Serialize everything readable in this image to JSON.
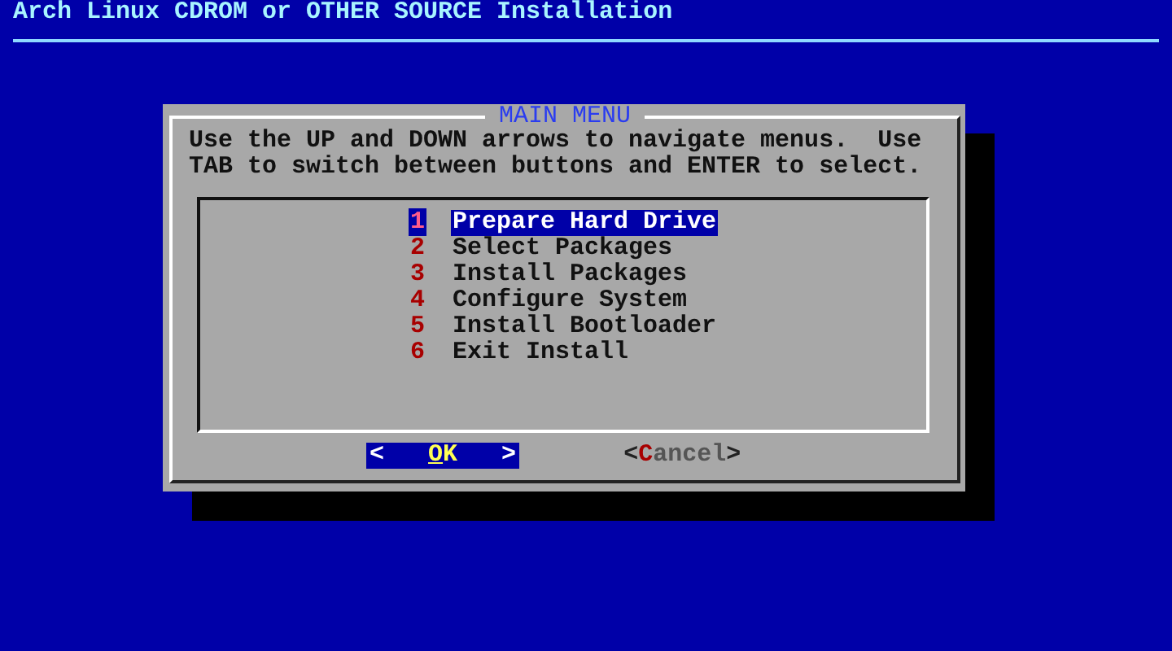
{
  "screen": {
    "title": "Arch Linux CDROM or OTHER SOURCE Installation"
  },
  "dialog": {
    "title": "MAIN MENU",
    "instructions": "Use the UP and DOWN arrows to navigate menus.  Use TAB to switch between buttons and ENTER to select.",
    "menu": [
      {
        "number": "1",
        "label": "Prepare Hard Drive",
        "selected": true
      },
      {
        "number": "2",
        "label": "Select Packages",
        "selected": false
      },
      {
        "number": "3",
        "label": "Install Packages",
        "selected": false
      },
      {
        "number": "4",
        "label": "Configure System",
        "selected": false
      },
      {
        "number": "5",
        "label": "Install Bootloader",
        "selected": false
      },
      {
        "number": "6",
        "label": "Exit Install",
        "selected": false
      }
    ],
    "buttons": [
      {
        "open": "<",
        "label": "OK",
        "close": ">",
        "selected": true
      },
      {
        "open": "<",
        "label": "Cancel",
        "close": ">",
        "selected": false
      }
    ]
  }
}
